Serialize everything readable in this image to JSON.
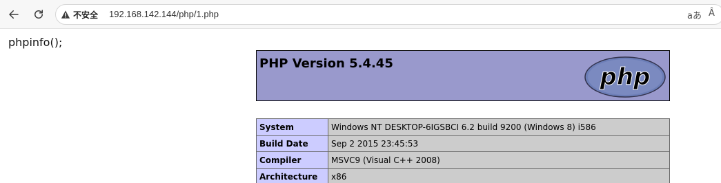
{
  "browser": {
    "security_label": "不安全",
    "url": "192.168.142.144/php/1.php",
    "read_aloud_icon_text": "aあ",
    "text_size_icon_text": "Â"
  },
  "page": {
    "code_text": "phpinfo();",
    "header": {
      "title": "PHP Version 5.4.45",
      "logo_text": "php"
    },
    "info_rows": [
      {
        "key": "System",
        "value": "Windows NT DESKTOP-6IGSBCI 6.2 build 9200 (Windows 8) i586"
      },
      {
        "key": "Build Date",
        "value": "Sep 2 2015 23:45:53"
      },
      {
        "key": "Compiler",
        "value": "MSVC9 (Visual C++ 2008)"
      },
      {
        "key": "Architecture",
        "value": "x86"
      }
    ]
  },
  "colors": {
    "header_bg": "#9999cc",
    "key_cell_bg": "#ccccff",
    "value_cell_bg": "#cccccc",
    "warning_icon": "#3c3c3c"
  }
}
